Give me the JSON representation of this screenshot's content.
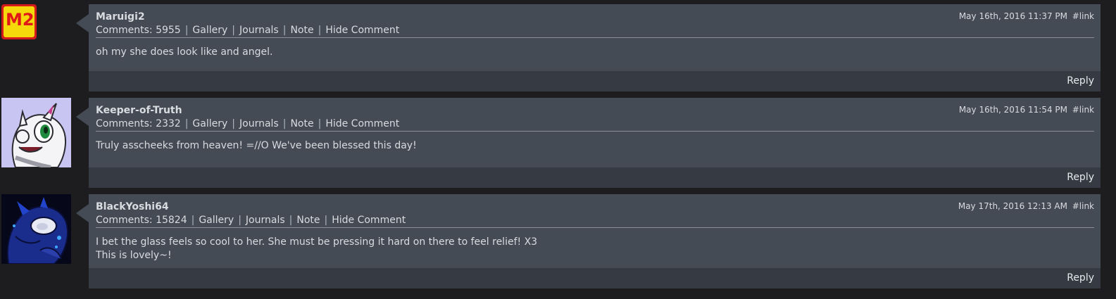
{
  "comments": [
    {
      "username": "Maruigi2",
      "comments_label": "Comments:",
      "comments_count": "5955",
      "links": [
        "Gallery",
        "Journals",
        "Note",
        "Hide Comment"
      ],
      "date": "May 16th, 2016 11:37 PM",
      "permalink": "#link",
      "body": [
        "oh my she does look like and angel."
      ],
      "reply_label": "Reply",
      "avatar_text": "M2"
    },
    {
      "username": "Keeper-of-Truth",
      "comments_label": "Comments:",
      "comments_count": "2332",
      "links": [
        "Gallery",
        "Journals",
        "Note",
        "Hide Comment"
      ],
      "date": "May 16th, 2016 11:54 PM",
      "permalink": "#link",
      "body": [
        "Truly asscheeks from heaven! =//O We've been blessed this day!"
      ],
      "reply_label": "Reply"
    },
    {
      "username": "BlackYoshi64",
      "comments_label": "Comments:",
      "comments_count": "15824",
      "links": [
        "Gallery",
        "Journals",
        "Note",
        "Hide Comment"
      ],
      "date": "May 17th, 2016 12:13 AM",
      "permalink": "#link",
      "body": [
        "I bet the glass feels so cool to her. She must be pressing it hard on there to feel relief! X3",
        "This is lovely~!"
      ],
      "reply_label": "Reply"
    }
  ]
}
